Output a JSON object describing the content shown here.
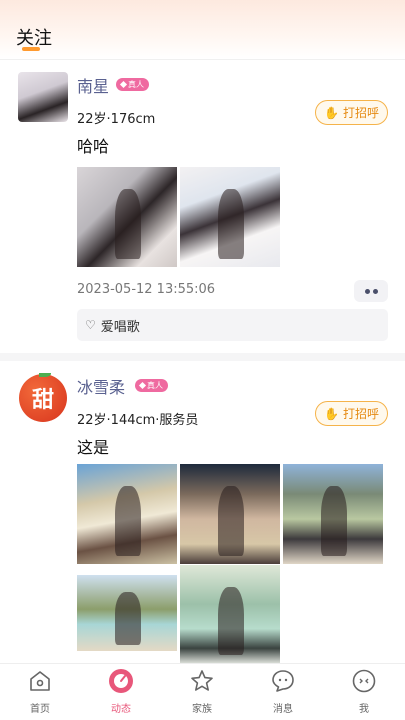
{
  "header": {
    "title": "关注"
  },
  "posts": [
    {
      "name": "南星",
      "badge": "真人",
      "meta": "22岁·176cm",
      "greet": "打招呼",
      "text": "哈哈",
      "time": "2023-05-12 13:55:06",
      "likes": "爱唱歌"
    },
    {
      "name": "冰雪柔",
      "badge": "真人",
      "meta": "22岁·144cm·服务员",
      "greet": "打招呼",
      "text": "这是",
      "avatar_text": "甜"
    }
  ],
  "tabs": [
    {
      "label": "首页",
      "icon": "home-icon"
    },
    {
      "label": "动态",
      "icon": "moment-icon",
      "active": true
    },
    {
      "label": "家族",
      "icon": "star-icon"
    },
    {
      "label": "消息",
      "icon": "message-icon"
    },
    {
      "label": "我",
      "icon": "profile-icon"
    }
  ],
  "colors": {
    "accent": "#ff9a2e",
    "badge": "#ef6aa0",
    "greet": "#e58a12",
    "name": "#5a6190",
    "active_tab": "#e8577a"
  }
}
